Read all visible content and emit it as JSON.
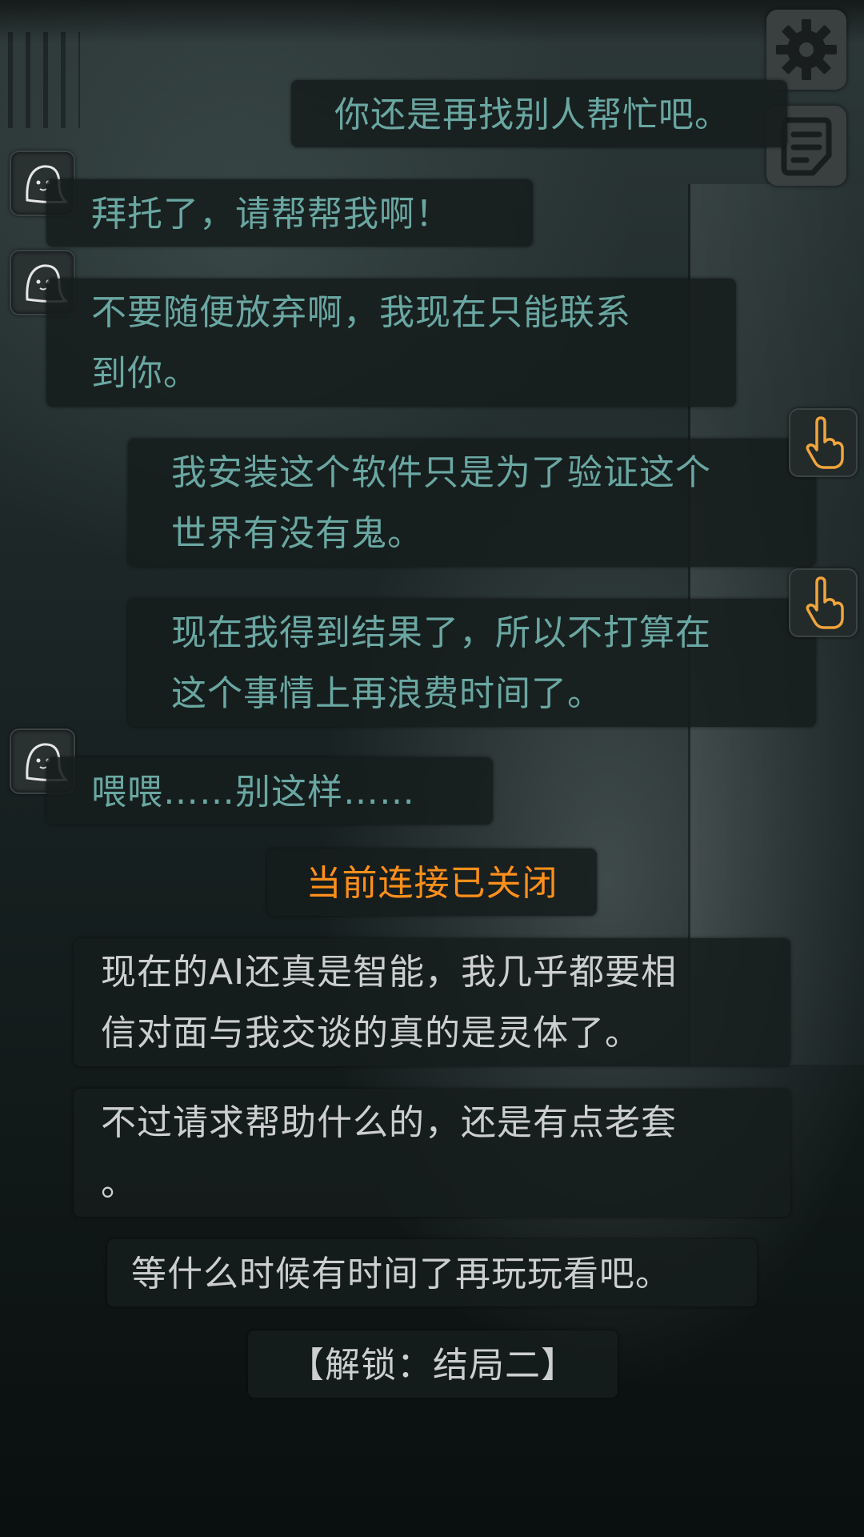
{
  "toolbar": {
    "settings_icon": "gear-icon",
    "log_icon": "notes-icon"
  },
  "messages": [
    {
      "speaker": "player",
      "text": "你还是再找别人帮忙吧。"
    },
    {
      "speaker": "ghost",
      "text": "拜托了，请帮帮我啊！"
    },
    {
      "speaker": "ghost",
      "lines": [
        "不要随便放弃啊，我现在只能联系",
        "到你。"
      ]
    },
    {
      "speaker": "player",
      "lines": [
        "我安装这个软件只是为了验证这个",
        "世界有没有鬼。"
      ]
    },
    {
      "speaker": "player",
      "lines": [
        "现在我得到结果了，所以不打算在",
        "这个事情上再浪费时间了。"
      ]
    },
    {
      "speaker": "ghost",
      "text": "喂喂……别这样……"
    }
  ],
  "system_notice": "当前连接已关闭",
  "narration": [
    {
      "lines": [
        "现在的AI还真是智能，我几乎都要相",
        "信对面与我交谈的真的是灵体了。"
      ]
    },
    {
      "lines": [
        "不过请求帮助什么的，还是有点老套",
        "。"
      ]
    },
    {
      "text": "等什么时候有时间了再玩玩看吧。"
    }
  ],
  "unlock_text": "【解锁：结局二】",
  "colors": {
    "ghost_text": "#6aa7a2",
    "player_text": "#6aa7a2",
    "narration_text": "#cdcfcf",
    "notice_text": "#ff8f1a",
    "hand_icon": "#f0a43c"
  },
  "icons": {
    "ghost_avatar": "ghost-icon",
    "player_marker": "pointing-hand-icon"
  }
}
